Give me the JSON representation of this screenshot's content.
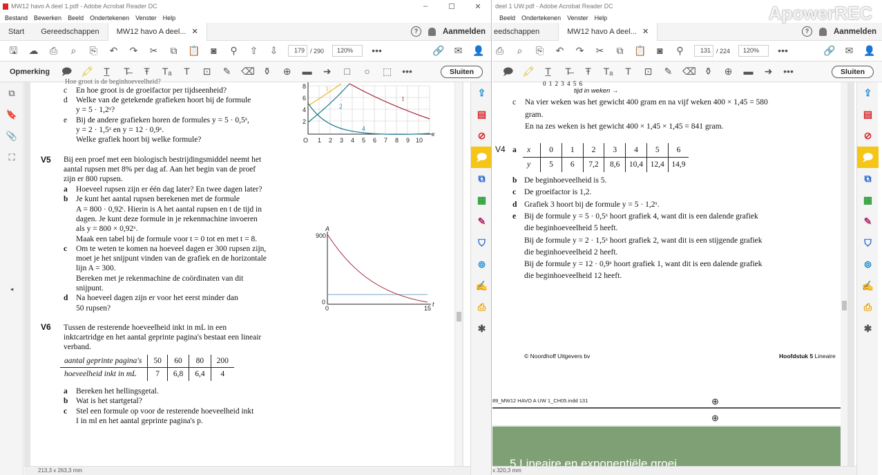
{
  "left": {
    "title": "MW12 havo A deel 1.pdf - Adobe Acrobat Reader DC",
    "menu": [
      "Bestand",
      "Bewerken",
      "Beeld",
      "Ondertekenen",
      "Venster",
      "Help"
    ],
    "tabs": {
      "start": "Start",
      "tools": "Gereedschappen",
      "doc": "MW12 havo A deel..."
    },
    "signin": "Aanmelden",
    "page_current": "179",
    "page_total": "/ 290",
    "zoom": "120%",
    "comment_label": "Opmerking",
    "close_label": "Sluiten",
    "status_size": "213,3 x 263,3 mm",
    "content": {
      "top_lines": [
        {
          "k": "c",
          "text": "En hoe groot is de groeifactor per tijdseenheid?"
        },
        {
          "k": "d",
          "text": "Welke van de getekende grafieken hoort bij de formule"
        },
        {
          "k": "",
          "text": "y = 5 · 1,2ˣ?"
        },
        {
          "k": "e",
          "text": "Bij de andere grafieken horen de formules y = 5 · 0,5ˣ,"
        },
        {
          "k": "",
          "text": "y = 2 · 1,5ˣ en y = 12 · 0,9ˣ."
        },
        {
          "k": "",
          "text": "Welke grafiek hoort bij welke formule?"
        }
      ],
      "v5_num": "V5",
      "v5_lines": [
        "Bij een proef met een biologisch bestrijdingsmiddel neemt het",
        "aantal rupsen met 8% per dag af. Aan het begin van de proef",
        "zijn er 800 rupsen."
      ],
      "v5_items": [
        {
          "k": "a",
          "text": "Hoeveel rupsen zijn er één dag later? En twee dagen later?"
        },
        {
          "k": "b",
          "text": "Je kunt het aantal rupsen berekenen met de formule"
        },
        {
          "k": "",
          "text": "A = 800 · 0,92ᵗ. Hierin is A het aantal rupsen en t de tijd in"
        },
        {
          "k": "",
          "text": "dagen. Je kunt deze formule in je rekenmachine invoeren"
        },
        {
          "k": "",
          "text": "als y = 800 × 0,92ˣ."
        },
        {
          "k": "",
          "text": "Maak een tabel bij de formule voor t = 0 tot en met t = 8."
        },
        {
          "k": "c",
          "text": "Om te weten te komen na hoeveel dagen er 300 rupsen zijn,"
        },
        {
          "k": "",
          "text": "moet je het snijpunt vinden van de grafiek en de horizontale"
        },
        {
          "k": "",
          "text": "lijn A = 300."
        },
        {
          "k": "",
          "text": "Bereken met je rekenmachine de coördinaten van dit"
        },
        {
          "k": "",
          "text": "snijpunt."
        },
        {
          "k": "d",
          "text": "Na hoeveel dagen zijn er voor het eerst minder dan"
        },
        {
          "k": "",
          "text": "50 rupsen?"
        }
      ],
      "v6_num": "V6",
      "v6_lines": [
        "Tussen de resterende hoeveelheid inkt in mL in een",
        "inktcartridge en het aantal geprinte pagina's bestaat een lineair",
        "verband."
      ],
      "v6_table": {
        "row1_label": "aantal geprinte pagina's",
        "row1": [
          "50",
          "60",
          "80",
          "200"
        ],
        "row2_label": "hoeveelheid inkt in mL",
        "row2": [
          "7",
          "6,8",
          "6,4",
          "4"
        ]
      },
      "v6_items": [
        {
          "k": "a",
          "text": "Bereken het hellingsgetal."
        },
        {
          "k": "b",
          "text": "Wat is het startgetal?"
        },
        {
          "k": "c",
          "text": "Stel een formule op voor de resterende hoeveelheid inkt"
        },
        {
          "k": "",
          "text": "I in ml en het aantal geprinte pagina's p."
        }
      ],
      "graph1": {
        "x_ticks": [
          "O",
          "1",
          "2",
          "3",
          "4",
          "5",
          "6",
          "7",
          "8",
          "9",
          "10"
        ],
        "y_ticks": [
          "8",
          "6",
          "4",
          "2"
        ],
        "x_label": "x",
        "curves": [
          "1",
          "2",
          "3",
          "4"
        ]
      },
      "graph2": {
        "y_label": "A",
        "y_top": "900",
        "origin": "0",
        "x_zero": "0",
        "x_end": "15",
        "x_label": "t"
      }
    }
  },
  "right": {
    "title": "deel 1 UW.pdf - Adobe Acrobat Reader DC",
    "menu": [
      "Beeld",
      "Ondertekenen",
      "Venster",
      "Help"
    ],
    "tabs": {
      "tools": "eedschappen",
      "doc": "MW12 havo A deel..."
    },
    "signin": "Aanmelden",
    "page_current": "131",
    "page_total": "/ 224",
    "zoom": "120%",
    "close_label": "Sluiten",
    "status_size": "x 320,3 mm",
    "content": {
      "axis_caption": "tijd in weken →",
      "axis_nums": "0  1  2  3  4  5  6",
      "c_lines": [
        "Na vier weken was het gewicht 400 gram en na vijf weken 400 × 1,45 = 580",
        "gram.",
        "En na zes weken is het gewicht 400 × 1,45 × 1,45 = 841 gram."
      ],
      "v4_num": "V4",
      "v4_table": {
        "row1_label": "x",
        "row1": [
          "0",
          "1",
          "2",
          "3",
          "4",
          "5",
          "6"
        ],
        "row2_label": "y",
        "row2": [
          "5",
          "6",
          "7,2",
          "8,6",
          "10,4",
          "12,4",
          "14,9"
        ]
      },
      "v4_items": [
        {
          "k": "b",
          "text": "De beginhoeveelheid is 5."
        },
        {
          "k": "c",
          "text": "De groeifactor is 1,2."
        },
        {
          "k": "d",
          "text": "Grafiek 3 hoort bij de formule y = 5 · 1,2ˣ."
        },
        {
          "k": "e",
          "text": "Bij de formule y = 5 · 0,5ˣ hoort grafiek 4, want dit is een dalende grafiek"
        },
        {
          "k": "",
          "text": "die beginhoeveelheid 5 heeft."
        },
        {
          "k": "",
          "text": "Bij de formule y = 2 · 1,5ˣ hoort grafiek 2, want dit is een stijgende grafiek"
        },
        {
          "k": "",
          "text": "die beginhoeveelheid 2 heeft."
        },
        {
          "k": "",
          "text": "Bij de formule y = 12 · 0,9ˣ hoort grafiek 1, want dit is een dalende grafiek"
        },
        {
          "k": "",
          "text": "die beginhoeveelheid 12 heeft."
        }
      ],
      "copyright": "© Noordhoff Uitgevers bv",
      "chapter": "Hoofdstuk 5",
      "chapter_rest": "Lineaire",
      "printline": "89_MW12 HAVO A UW 1_CH05.indd   131",
      "band_title": "5  Lineaire en exponentiële groei"
    }
  },
  "watermark": "ApowerREC",
  "colors": {
    "accent": "#f5c518",
    "curve_red": "#a8263b",
    "curve_teal": "#1f7c93",
    "curve_yellow": "#e8b428",
    "band": "#7fa075"
  }
}
